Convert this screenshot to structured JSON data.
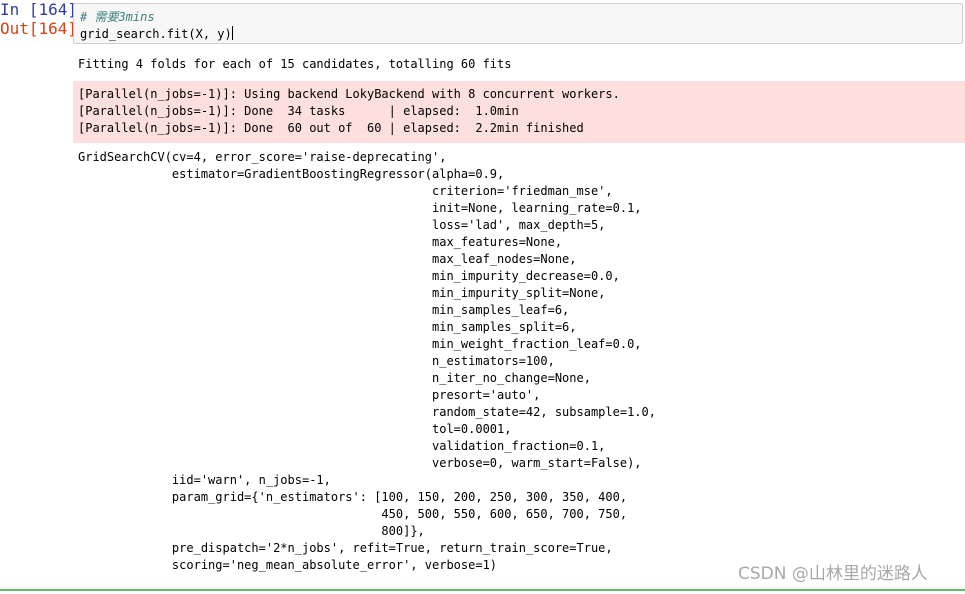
{
  "input_prompt": "In  [164]:",
  "output_prompt": "Out[164]:",
  "code": {
    "comment": "# 需要3mins",
    "line2": "grid_search.fit(X, y)"
  },
  "stdout": "Fitting 4 folds for each of 15 candidates, totalling 60 fits",
  "stderr": [
    "[Parallel(n_jobs=-1)]: Using backend LokyBackend with 8 concurrent workers.",
    "[Parallel(n_jobs=-1)]: Done  34 tasks      | elapsed:  1.0min",
    "[Parallel(n_jobs=-1)]: Done  60 out of  60 | elapsed:  2.2min finished"
  ],
  "result": [
    "GridSearchCV(cv=4, error_score='raise-deprecating',",
    "             estimator=GradientBoostingRegressor(alpha=0.9,",
    "                                                 criterion='friedman_mse',",
    "                                                 init=None, learning_rate=0.1,",
    "                                                 loss='lad', max_depth=5,",
    "                                                 max_features=None,",
    "                                                 max_leaf_nodes=None,",
    "                                                 min_impurity_decrease=0.0,",
    "                                                 min_impurity_split=None,",
    "                                                 min_samples_leaf=6,",
    "                                                 min_samples_split=6,",
    "                                                 min_weight_fraction_leaf=0.0,",
    "                                                 n_estimators=100,",
    "                                                 n_iter_no_change=None,",
    "                                                 presort='auto',",
    "                                                 random_state=42, subsample=1.0,",
    "                                                 tol=0.0001,",
    "                                                 validation_fraction=0.1,",
    "                                                 verbose=0, warm_start=False),",
    "             iid='warn', n_jobs=-1,",
    "             param_grid={'n_estimators': [100, 150, 200, 250, 300, 350, 400,",
    "                                          450, 500, 550, 600, 650, 700, 750,",
    "                                          800]},",
    "             pre_dispatch='2*n_jobs', refit=True, return_train_score=True,",
    "             scoring='neg_mean_absolute_error', verbose=1)"
  ],
  "watermark": "CSDN @山林里的迷路人",
  "colors": {
    "input_prompt": "#303f9f",
    "output_prompt": "#d84315",
    "stderr_background": "#fddfdd",
    "input_background": "#f7f7f7",
    "comment": "#408080",
    "bottom_border": "#66bb6a"
  }
}
